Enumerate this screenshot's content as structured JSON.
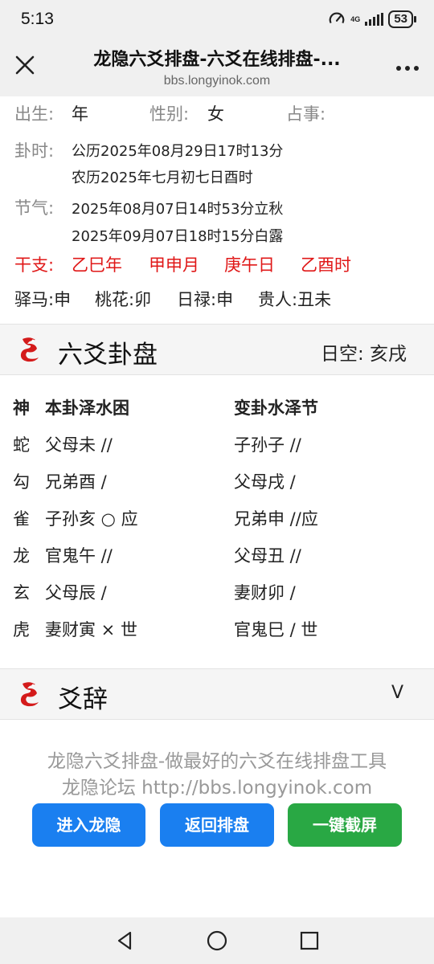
{
  "status": {
    "time": "5:13",
    "network": "4G",
    "battery": "53"
  },
  "browser": {
    "title": "龙隐六爻排盘-六爻在线排盘-...",
    "url": "bbs.longyinok.com"
  },
  "info": {
    "birth_label": "出生:",
    "birth_value": "年",
    "gender_label": "性别:",
    "gender_value": "女",
    "matter_label": "占事:",
    "gua_time_label": "卦时:",
    "gua_time_solar": "公历2025年08月29日17时13分",
    "gua_time_lunar": "农历2025年七月初七日酉时",
    "jieqi_label": "节气:",
    "jieqi_1": "2025年08月07日14时53分立秋",
    "jieqi_2": "2025年09月07日18时15分白露",
    "ganzhi_label": "干支:",
    "ganzhi": [
      "乙巳年",
      "甲申月",
      "庚午日",
      "乙酉时"
    ],
    "shensha": [
      "驿马:申",
      "桃花:卯",
      "日禄:申",
      "贵人:丑未"
    ]
  },
  "paipan": {
    "title": "六爻卦盘",
    "rikong": "日空:  亥戌",
    "header": {
      "shen": "神",
      "ben": "本卦泽水困",
      "bian": "变卦水泽节"
    },
    "rows": [
      {
        "shen": "蛇",
        "ben": "父母未 //",
        "bian": "子孙子 //"
      },
      {
        "shen": "勾",
        "ben": "兄弟酉  /",
        "bian": "父母戌  /"
      },
      {
        "shen": "雀",
        "ben": "子孙亥 ○ 应",
        "bian": "兄弟申 //应"
      },
      {
        "shen": "龙",
        "ben": "官鬼午 //",
        "bian": "父母丑 //"
      },
      {
        "shen": "玄",
        "ben": "父母辰  /",
        "bian": "妻财卯  /"
      },
      {
        "shen": "虎",
        "ben": "妻财寅 × 世",
        "bian": "官鬼巳  / 世"
      }
    ]
  },
  "yaoci": {
    "title": "爻辞",
    "toggle": "V"
  },
  "footer": {
    "line1": "龙隐六爻排盘-做最好的六爻在线排盘工具",
    "line2": "龙隐论坛 http://bbs.longyinok.com",
    "buttons": [
      "进入龙隐",
      "返回排盘",
      "一键截屏"
    ]
  },
  "colors": {
    "red": "#e01818",
    "blue_button": "#1a7ff0",
    "green_button": "#29a844"
  }
}
